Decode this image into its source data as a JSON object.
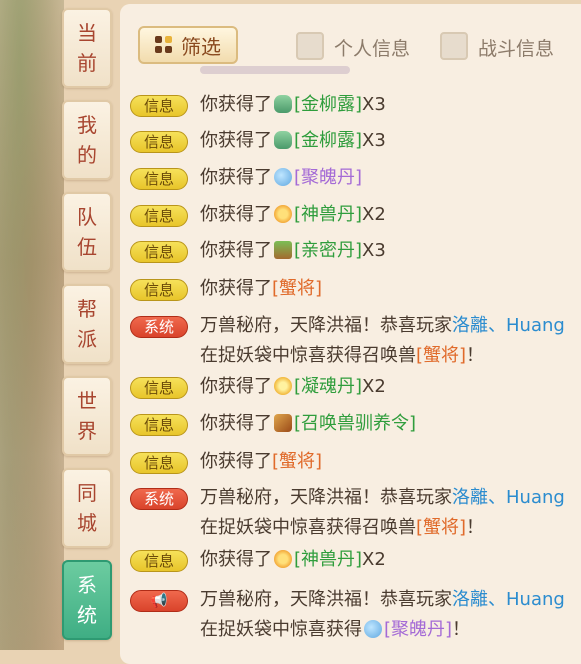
{
  "tabs": [
    {
      "label_line1": "当",
      "label_line2": "前",
      "active": false
    },
    {
      "label_line1": "我",
      "label_line2": "的",
      "active": false
    },
    {
      "label_line1": "队",
      "label_line2": "伍",
      "active": false
    },
    {
      "label_line1": "帮",
      "label_line2": "派",
      "active": false
    },
    {
      "label_line1": "世",
      "label_line2": "界",
      "active": false
    },
    {
      "label_line1": "同",
      "label_line2": "城",
      "active": false
    },
    {
      "label_line1": "系",
      "label_line2": "统",
      "active": true
    }
  ],
  "filter": {
    "button_label": "筛选",
    "personal_label": "个人信息",
    "battle_label": "战斗信息"
  },
  "badges": {
    "info": "信息",
    "system": "系统",
    "horn": "📢"
  },
  "messages": [
    {
      "prefix": "你获得了",
      "item": "[金柳露]",
      "suffix": "X3"
    },
    {
      "prefix": "你获得了",
      "item": "[金柳露]",
      "suffix": "X3"
    },
    {
      "prefix": "你获得了",
      "item": "[聚魄丹]",
      "suffix": ""
    },
    {
      "prefix": "你获得了",
      "item": "[神兽丹]",
      "suffix": "X2"
    },
    {
      "prefix": "你获得了",
      "item": "[亲密丹]",
      "suffix": "X3"
    },
    {
      "prefix": "你获得了",
      "item": "[蟹将]",
      "suffix": ""
    },
    {
      "prefix": "万兽秘府，天降洪福！恭喜玩家",
      "player": "洛離、Huang",
      "mid": "在捉妖袋中惊喜获得召唤兽",
      "item": "[蟹将]",
      "suffix": "！"
    },
    {
      "prefix": "你获得了",
      "item": "[凝魂丹]",
      "suffix": "X2"
    },
    {
      "prefix": "你获得了",
      "item": "[召唤兽驯养令]",
      "suffix": ""
    },
    {
      "prefix": "你获得了",
      "item": "[蟹将]",
      "suffix": ""
    },
    {
      "prefix": "万兽秘府，天降洪福！恭喜玩家",
      "player": "洛離、Huang",
      "mid": "在捉妖袋中惊喜获得召唤兽",
      "item": "[蟹将]",
      "suffix": "！"
    },
    {
      "prefix": "你获得了",
      "item": "[神兽丹]",
      "suffix": "X2"
    },
    {
      "prefix": "万兽秘府，天降洪福！恭喜玩家",
      "player": "洛離、Huang",
      "mid": "在捉妖袋中惊喜获得",
      "item": "[聚魄丹]",
      "suffix": "！"
    }
  ],
  "colors": {
    "item_green": "#2f9d3c",
    "item_purple": "#a46ad6",
    "item_orange": "#e06a2a",
    "player_blue": "#2b8ccf",
    "active_tab": "#3fae84"
  }
}
